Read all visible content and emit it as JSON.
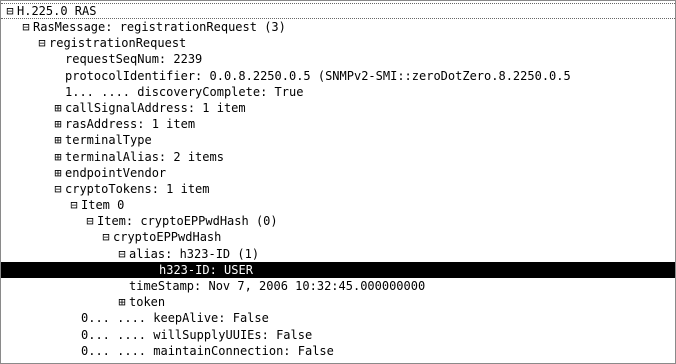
{
  "tree": {
    "rows": [
      {
        "toggle": "⊟",
        "text": "H.225.0 RAS"
      },
      {
        "toggle": "⊟",
        "text": "RasMessage: registrationRequest (3)"
      },
      {
        "toggle": "⊟",
        "text": "registrationRequest"
      },
      {
        "toggle": "",
        "text": "requestSeqNum: 2239"
      },
      {
        "toggle": "",
        "text": "protocolIdentifier: 0.0.8.2250.0.5 (SNMPv2-SMI::zeroDotZero.8.2250.0.5"
      },
      {
        "toggle": "",
        "text": "1... .... discoveryComplete: True"
      },
      {
        "toggle": "⊞",
        "text": "callSignalAddress: 1 item"
      },
      {
        "toggle": "⊞",
        "text": "rasAddress: 1 item"
      },
      {
        "toggle": "⊞",
        "text": "terminalType"
      },
      {
        "toggle": "⊞",
        "text": "terminalAlias: 2 items"
      },
      {
        "toggle": "⊞",
        "text": "endpointVendor"
      },
      {
        "toggle": "⊟",
        "text": "cryptoTokens: 1 item"
      },
      {
        "toggle": "⊟",
        "text": "Item 0"
      },
      {
        "toggle": "⊟",
        "text": "Item: cryptoEPPwdHash (0)"
      },
      {
        "toggle": "⊟",
        "text": "cryptoEPPwdHash"
      },
      {
        "toggle": "⊟",
        "text": "alias: h323-ID (1)"
      },
      {
        "toggle": "",
        "text": "h323-ID: USER"
      },
      {
        "toggle": "",
        "text": "timeStamp: Nov  7, 2006 10:32:45.000000000"
      },
      {
        "toggle": "⊞",
        "text": "token"
      },
      {
        "toggle": "",
        "text": "0... .... keepAlive: False"
      },
      {
        "toggle": "",
        "text": "0... .... willSupplyUUIEs: False"
      },
      {
        "toggle": "",
        "text": "0... .... maintainConnection: False"
      }
    ]
  }
}
